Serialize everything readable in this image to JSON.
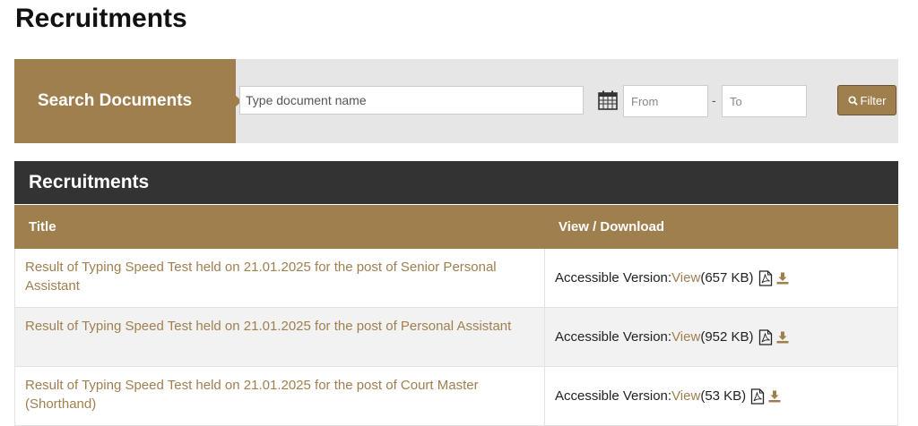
{
  "page": {
    "title": "Recruitments"
  },
  "search": {
    "label": "Search Documents",
    "placeholder": "Type document name",
    "from_placeholder": "From",
    "separator": "-",
    "to_placeholder": "To",
    "filter_label": "Filter"
  },
  "table": {
    "heading": "Recruitments",
    "columns": {
      "title": "Title",
      "view": "View / Download"
    },
    "rows": [
      {
        "title": "Result of Typing Speed Test held on 21.01.2025 for the post of Senior Personal Assistant",
        "version_label": "Accessible Version",
        "separator": ":",
        "view_label": "View",
        "size": "(657 KB)"
      },
      {
        "title": "Result of Typing Speed Test held on 21.01.2025 for the post of Personal Assistant",
        "version_label": "Accessible Version",
        "separator": ":",
        "view_label": "View",
        "size": "(952 KB)"
      },
      {
        "title": "Result of Typing Speed Test held on 21.01.2025 for the post of Court Master (Shorthand)",
        "version_label": "Accessible Version",
        "separator": ":",
        "view_label": "View",
        "size": "(53 KB)"
      }
    ]
  },
  "colors": {
    "accent": "#a07f4f",
    "heading_bg": "#333333",
    "search_bg": "#e6e6e6"
  },
  "icons": [
    "calendar-icon",
    "search-icon",
    "pdf-icon",
    "download-icon"
  ]
}
